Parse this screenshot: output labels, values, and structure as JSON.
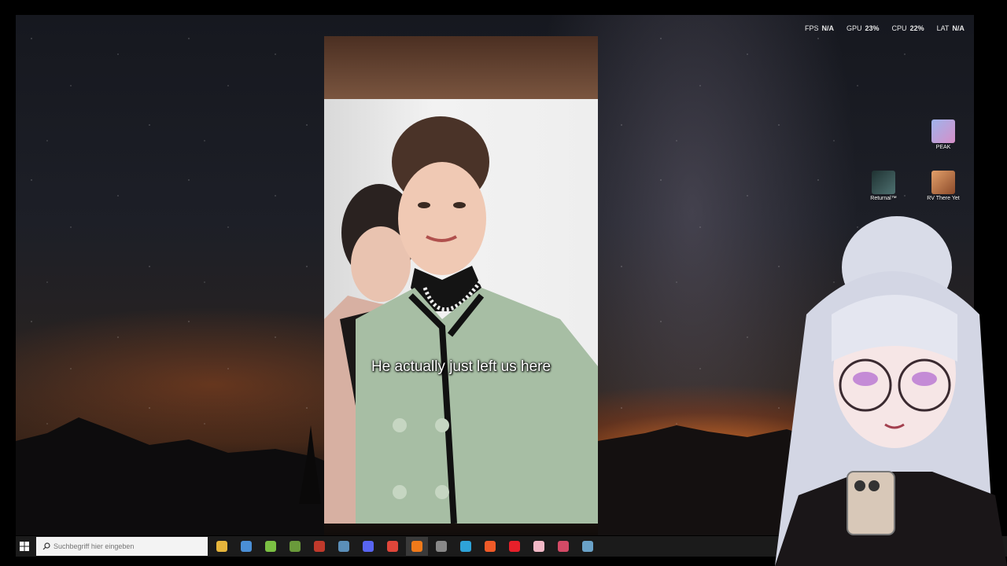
{
  "perf_overlay": {
    "fps": {
      "label": "FPS",
      "value": "N/A"
    },
    "gpu": {
      "label": "GPU",
      "value": "23%"
    },
    "cpu": {
      "label": "CPU",
      "value": "22%"
    },
    "lat": {
      "label": "LAT",
      "value": "N/A"
    }
  },
  "video": {
    "subtitle": "He actually just left us here"
  },
  "desktop_icons": [
    {
      "label": "PEAK",
      "icon": "peak-game-icon",
      "color": "#7a8fd0"
    },
    {
      "label": "Returnal™",
      "icon": "returnal-game-icon",
      "color": "#2f4a4a"
    },
    {
      "label": "RV There Yet",
      "icon": "rv-there-yet-game-icon",
      "color": "#c9743a"
    }
  ],
  "taskbar": {
    "search_placeholder": "Suchbegriff hier eingeben",
    "apps": [
      {
        "name": "file-explorer-icon",
        "color": "#e6b53c"
      },
      {
        "name": "microsoft-store-icon",
        "color": "#4a8fd6"
      },
      {
        "name": "android-app-icon",
        "color": "#7bc043"
      },
      {
        "name": "minecraft-icon",
        "color": "#6a9a3b"
      },
      {
        "name": "vtuber-app-icon",
        "color": "#c0392b"
      },
      {
        "name": "steam-icon",
        "color": "#5b8fb9"
      },
      {
        "name": "discord-icon",
        "color": "#5865f2"
      },
      {
        "name": "chrome-icon",
        "color": "#e0463a"
      },
      {
        "name": "firefox-icon",
        "color": "#f07a1a"
      },
      {
        "name": "obs-icon",
        "color": "#888888"
      },
      {
        "name": "edge-icon",
        "color": "#2ea3d9"
      },
      {
        "name": "brave-icon",
        "color": "#f05a28"
      },
      {
        "name": "opera-icon",
        "color": "#e8202a"
      },
      {
        "name": "paint-app-icon",
        "color": "#f2b8c6"
      },
      {
        "name": "controller-app-icon",
        "color": "#d44a66"
      },
      {
        "name": "steam-secondary-icon",
        "color": "#6aa2c8"
      }
    ]
  }
}
